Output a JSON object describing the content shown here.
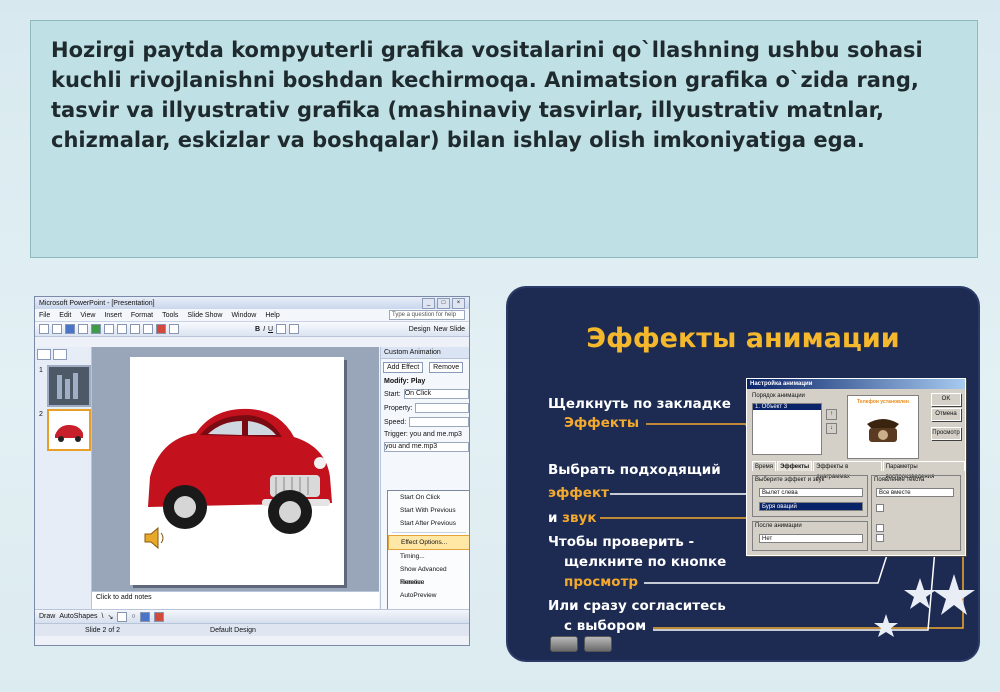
{
  "paragraph": "Hozirgi paytda kompyuterli grafika vositalarini qo`llashning ushbu sohasi kuchli rivojlanishni boshdan kechirmoqa. Animatsion grafika o`zida rang, tasvir va illyustrativ grafika (mashinaviy tasvirlar, illyustrativ matnlar, chizmalar, eskizlar va boshqalar) bilan ishlay olish imkoniyatiga ega.",
  "ppt": {
    "title": "Microsoft PowerPoint - [Presentation]",
    "menu": [
      "File",
      "Edit",
      "View",
      "Insert",
      "Format",
      "Tools",
      "Slide Show",
      "Window",
      "Help"
    ],
    "help_placeholder": "Type a question for help",
    "design_label": "Design",
    "new_slide_label": "New Slide",
    "task_pane_title": "Custom Animation",
    "add_effect": "Add Effect",
    "remove": "Remove",
    "modify": "Modify: Play",
    "start_label": "Start:",
    "start_value": "On Click",
    "property_label": "Property:",
    "speed_label": "Speed:",
    "trigger": "Trigger: you and me.mp3",
    "item": "you and me.mp3",
    "context_menu": [
      "Start On Click",
      "Start With Previous",
      "Start After Previous",
      "Effect Options...",
      "Timing...",
      "Show Advanced Timeline",
      "Remove"
    ],
    "autopreview": "AutoPreview",
    "notes": "Click to add notes",
    "draw": "Draw",
    "autoshapes": "AutoShapes",
    "status_slide": "Slide 2 of 2",
    "status_design": "Default Design",
    "slide_numbers": [
      "1",
      "2"
    ]
  },
  "fx": {
    "title": "Эффекты анимации",
    "line1": "Щелкнуть по закладке",
    "line1_hl": "Эффекты",
    "line2": "Выбрать подходящий",
    "line3_hl": "эффект",
    "line4_pre": "и ",
    "line4_hl": "звук",
    "line5": "Чтобы проверить -",
    "line6": "щелкните по кнопке",
    "line7_hl": "просмотр",
    "line8": "Или сразу согласитесь",
    "line9": "с выбором",
    "dialog": {
      "title": "Настройка анимации",
      "order_label": "Порядок анимации",
      "order_item": "1. Объект 3",
      "preview_caption": "Телефон установлен",
      "ok": "OK",
      "cancel": "Отмена",
      "preview_btn": "Просмотр",
      "tabs": [
        "Время",
        "Эффекты",
        "Эффекты в диаграммах",
        "Параметры воспроизведения"
      ],
      "effect_group": "Выберите эффект и звук",
      "effect_value": "Вылет слева",
      "sound_value": "Буря оваций",
      "text_group": "Появление текста",
      "text_value": "Все вместе",
      "after_group": "После анимации",
      "after_value": "Нет"
    }
  },
  "colors": {
    "accent_orange": "#f3a92e",
    "fx_background": "#1d2b52",
    "textbox_bg": "#bfe0e4"
  }
}
